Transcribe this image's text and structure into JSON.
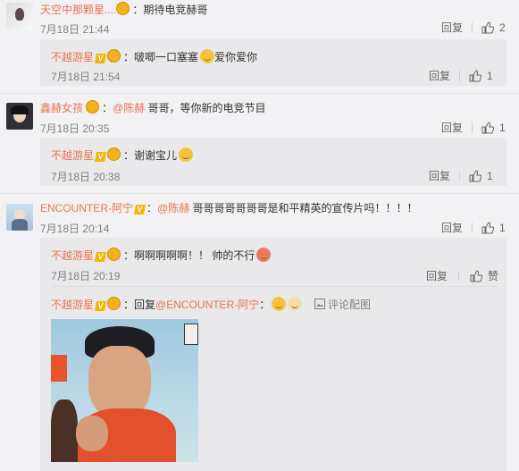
{
  "comments": [
    {
      "author": "天空中那颗星....",
      "sep": "：",
      "text": "期待电竞赫哥",
      "time": "7月18日 21:44",
      "reply_label": "回复",
      "likes": "2",
      "replies": [
        {
          "author": "不越游星",
          "sep": "：",
          "text": "啵唧一口塞塞",
          "text_after": "爱你爱你",
          "time": "7月18日 21:54",
          "reply_label": "回复",
          "likes": "1"
        }
      ]
    },
    {
      "author": "鑫赫女孩",
      "sep": "：",
      "mention": "@陈赫",
      "text": " 哥哥，等你新的电竞节目",
      "time": "7月18日 20:35",
      "reply_label": "回复",
      "likes": "1",
      "replies": [
        {
          "author": "不越游星",
          "sep": "：",
          "text": "谢谢宝儿",
          "time": "7月18日 20:38",
          "reply_label": "回复",
          "likes": "1"
        }
      ]
    },
    {
      "author": "ENCOUNTER-阿宁",
      "sep": "：",
      "mention": "@陈赫",
      "text": " 哥哥哥哥哥哥哥是和平精英的宣传片吗！！！！",
      "time": "7月18日 20:14",
      "reply_label": "回复",
      "likes": "1",
      "replies": [
        {
          "author": "不越游星",
          "sep": "：",
          "text": "啊啊啊啊啊！！ 帅的不行",
          "time": "7月18日 20:19",
          "reply_label": "回复",
          "like_label": "赞"
        },
        {
          "author": "不越游星",
          "sep": "：",
          "prefix": "回复",
          "mention": "@ENCOUNTER-阿宁",
          "text": "：",
          "image_link": "评论配图"
        }
      ]
    }
  ]
}
